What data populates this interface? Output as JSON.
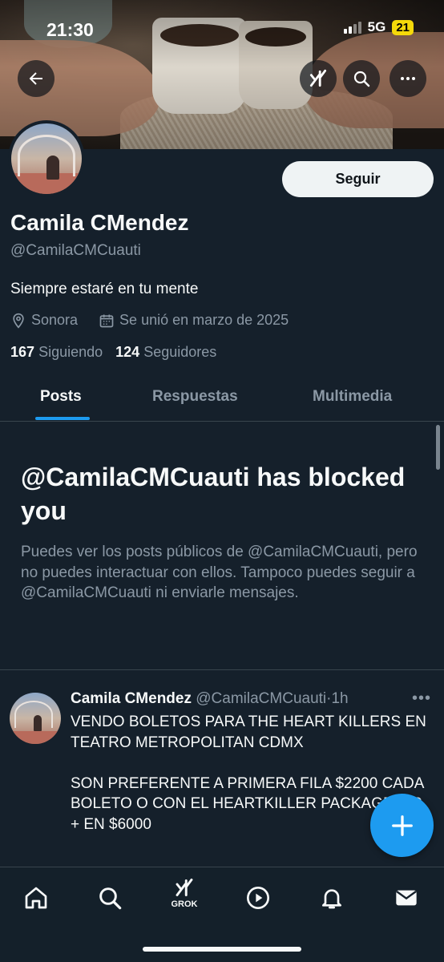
{
  "status_bar": {
    "time": "21:30",
    "network": "5G",
    "battery": "21"
  },
  "profile": {
    "name": "Camila CMendez",
    "handle": "@CamilaCMCuauti",
    "bio": "Siempre estaré en tu mente",
    "location": "Sonora",
    "joined": "Se unió en marzo de 2025",
    "following_count": "167",
    "following_label": "Siguiendo",
    "followers_count": "124",
    "followers_label": "Seguidores",
    "follow_button": "Seguir"
  },
  "tabs": [
    {
      "label": "Posts",
      "active": true
    },
    {
      "label": "Respuestas",
      "active": false
    },
    {
      "label": "Multimedia",
      "active": false
    }
  ],
  "blocked_notice": {
    "title": "@CamilaCMCuauti has blocked you",
    "description": "Puedes ver los posts públicos de @CamilaCMCuauti, pero no puedes interactuar con ellos. Tampoco puedes seguir a @CamilaCMCuauti ni enviarle mensajes."
  },
  "post": {
    "author_name": "Camila CMendez",
    "author_handle": "@CamilaCMCuauti",
    "separator": "·",
    "time": "1h",
    "text": "VENDO BOLETOS PARA THE HEART KILLERS EN TEATRO METROPOLITAN CDMX\n\nSON PREFERENTE A PRIMERA FILA $2200 CADA BOLETO O CON EL HEARTKILLER PACKAGE VIP + EN $6000"
  },
  "bottom_nav": {
    "items": [
      "home-icon",
      "search-icon",
      "grok-icon",
      "video-icon",
      "notifications-icon",
      "messages-icon"
    ],
    "grok_label": "GROK"
  },
  "colors": {
    "accent": "#1d9bf0",
    "background": "#15202b",
    "secondary_text": "#8b98a5"
  }
}
